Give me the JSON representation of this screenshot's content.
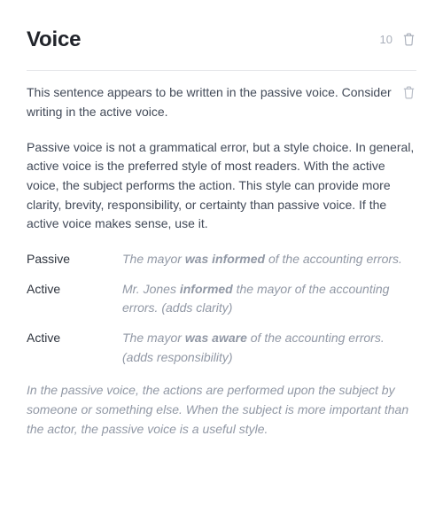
{
  "header": {
    "title": "Voice",
    "count": "10"
  },
  "intro": "This sentence appears to be written in the passive voice. Consider writing in the active voice.",
  "explanation": "Passive voice is not a grammatical error, but a style choice. In general, active voice is the preferred style of most readers. With the active voice, the subject performs the action. This style can provide more clarity, brevity, responsibility, or certainty than passive voice. If the active voice makes sense, use it.",
  "examples": [
    {
      "label": "Passive",
      "pre": "The mayor ",
      "bold": "was informed",
      "post": " of the accounting errors."
    },
    {
      "label": "Active",
      "pre": "Mr. Jones ",
      "bold": "informed",
      "post": " the mayor of the accounting errors. (adds clarity)"
    },
    {
      "label": "Active",
      "pre": "The mayor ",
      "bold": "was aware",
      "post": " of the accounting errors. (adds responsibility)"
    }
  ],
  "footnote": "In the passive voice, the actions are performed upon the subject by someone or something else. When the subject is more important than the actor, the passive voice is a useful style."
}
